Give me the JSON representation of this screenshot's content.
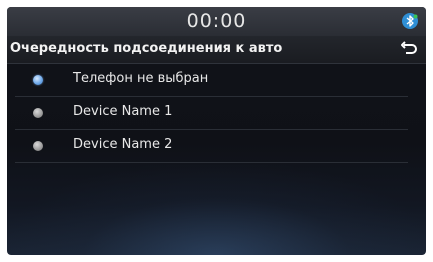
{
  "status_bar": {
    "clock": "00:00",
    "bluetooth_icon": "bluetooth-icon"
  },
  "header": {
    "title": "Очередность подсоединения к авто",
    "back_icon": "back-arrow-icon"
  },
  "list": {
    "items": [
      {
        "label": "Телефон не выбран",
        "selected": true
      },
      {
        "label": "Device Name 1",
        "selected": false
      },
      {
        "label": "Device Name 2",
        "selected": false
      }
    ]
  },
  "colors": {
    "accent": "#4a8fe0",
    "background": "#111319",
    "text": "#e8e8e8"
  }
}
